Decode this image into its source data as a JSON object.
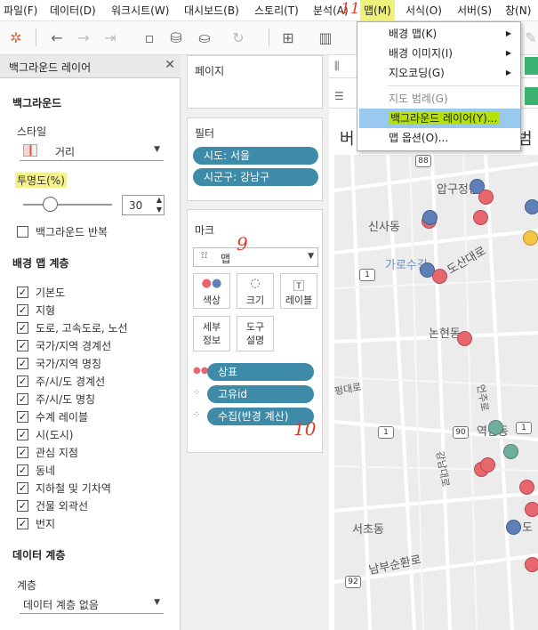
{
  "menubar": {
    "items": [
      {
        "label": "파일(F)"
      },
      {
        "label": "데이터(D)"
      },
      {
        "label": "워크시트(W)"
      },
      {
        "label": "대시보드(B)"
      },
      {
        "label": "스토리(T)"
      },
      {
        "label": "분석(A)"
      },
      {
        "label": "맵(M)"
      },
      {
        "label": "서식(O)"
      },
      {
        "label": "서버(S)"
      },
      {
        "label": "창(N)"
      }
    ]
  },
  "left_panel": {
    "title": "백그라운드 레이어",
    "background_section": "백그라운드",
    "style_label": "스타일",
    "style_value": "거리",
    "opacity_label": "투명도(%)",
    "opacity_value": "30",
    "opacity_fraction": 0.3,
    "repeat_label": "백그라운드 반복",
    "layers_section": "배경 맵 계층",
    "layers": [
      {
        "label": "기본도",
        "checked": true
      },
      {
        "label": "지형",
        "checked": true
      },
      {
        "label": "도로, 고속도로, 노선",
        "checked": true
      },
      {
        "label": "국가/지역 경계선",
        "checked": true
      },
      {
        "label": "국가/지역 명칭",
        "checked": true
      },
      {
        "label": "주/시/도 경계선",
        "checked": true
      },
      {
        "label": "주/시/도 명칭",
        "checked": true
      },
      {
        "label": "수계 레이블",
        "checked": true
      },
      {
        "label": "시(도시)",
        "checked": true
      },
      {
        "label": "관심 지점",
        "checked": true
      },
      {
        "label": "동네",
        "checked": true
      },
      {
        "label": "지하철 및 기차역",
        "checked": true
      },
      {
        "label": "건물 외곽선",
        "checked": true
      },
      {
        "label": "번지",
        "checked": true
      }
    ],
    "data_layer_section": "데이터 계층",
    "data_layer_label": "계층",
    "data_layer_value": "데이터 계층 없음"
  },
  "cards": {
    "pages_title": "페이지",
    "filters_title": "필터",
    "filters": [
      "시도: 서울",
      "시군구: 강남구"
    ],
    "marks_title": "마크",
    "marks_type": "맵",
    "mark_buttons": {
      "color": "색상",
      "size": "크기",
      "label": "레이블",
      "detail": "세부\n정보",
      "tooltip": "도구\n설명"
    },
    "mark_fields": [
      {
        "icon": "color-dots-icon",
        "label": "상표"
      },
      {
        "icon": "detail-dots-icon",
        "label": "고유id"
      },
      {
        "icon": "detail-dots-icon",
        "label": "수집(반경 계산)"
      }
    ]
  },
  "view": {
    "title_partial": "버",
    "title_partial_right": "범",
    "map_labels": [
      {
        "text": "압구정동",
        "blue": false
      },
      {
        "text": "신사동",
        "blue": false
      },
      {
        "text": "가로수길",
        "blue": true
      },
      {
        "text": "도산대로",
        "blue": false
      },
      {
        "text": "논현동",
        "blue": false
      },
      {
        "text": "펑대로",
        "blue": false
      },
      {
        "text": "서초동",
        "blue": false
      },
      {
        "text": "남부순환로",
        "blue": false
      },
      {
        "text": "강남대로",
        "blue": false
      },
      {
        "text": "언주로",
        "blue": false
      },
      {
        "text": "역삼동",
        "blue": false
      },
      {
        "text": "도",
        "blue": false
      }
    ],
    "road_shields": [
      "88",
      "1",
      "1",
      "90",
      "1",
      "92"
    ],
    "dot_colors": {
      "red": "#e8666e",
      "blue": "#5e7fb8",
      "yellow": "#f2c744",
      "teal": "#6fae9c"
    }
  },
  "map_menu": {
    "items": [
      {
        "label": "배경 맵(K)",
        "submenu": true,
        "disabled": false,
        "selected": false
      },
      {
        "label": "배경 이미지(I)",
        "submenu": true,
        "disabled": false,
        "selected": false
      },
      {
        "label": "지오코딩(G)",
        "submenu": true,
        "disabled": false,
        "selected": false
      },
      {
        "label": "지도 범례(G)",
        "submenu": false,
        "disabled": true,
        "selected": false
      },
      {
        "label": "백그라운드 레이어(Y)...",
        "submenu": false,
        "disabled": false,
        "selected": true
      },
      {
        "label": "맵 옵션(O)...",
        "submenu": false,
        "disabled": false,
        "selected": false
      }
    ]
  },
  "annotations": [
    "11",
    "9",
    "10"
  ]
}
